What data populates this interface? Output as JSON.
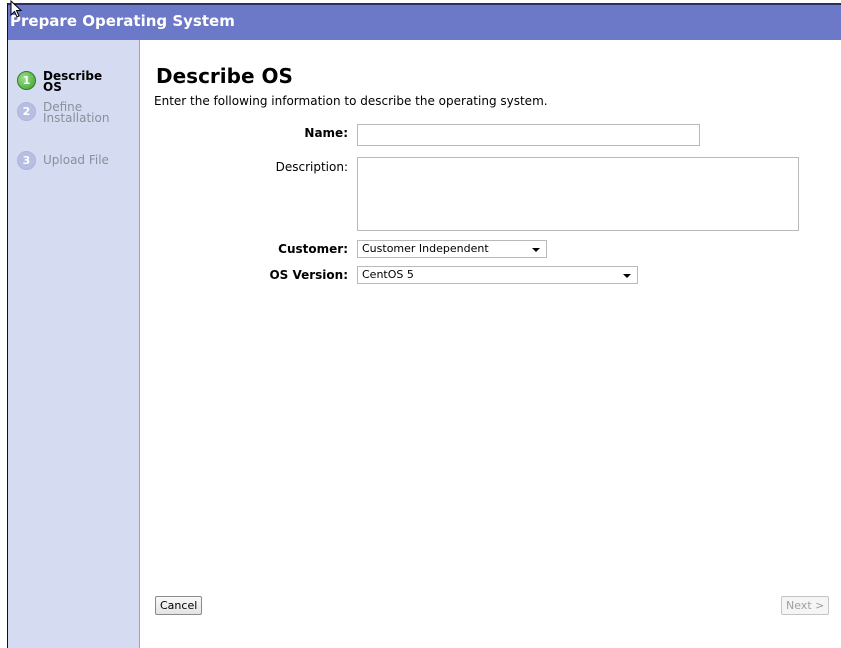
{
  "window": {
    "title": "Prepare Operating System"
  },
  "steps": [
    {
      "number": "1",
      "label_line1": "Describe",
      "label_line2": "OS",
      "state": "active"
    },
    {
      "number": "2",
      "label_line1": "Define",
      "label_line2": "Installation",
      "state": "inactive"
    },
    {
      "number": "3",
      "label_line1": "Upload File",
      "label_line2": "",
      "state": "inactive"
    }
  ],
  "main": {
    "heading": "Describe OS",
    "intro": "Enter the following information to describe the operating system."
  },
  "form": {
    "name": {
      "label": "Name:",
      "value": ""
    },
    "description": {
      "label": "Description:",
      "value": ""
    },
    "customer": {
      "label": "Customer:",
      "selected": "Customer Independent"
    },
    "os_version": {
      "label": "OS Version:",
      "selected": "CentOS 5"
    }
  },
  "buttons": {
    "cancel": "Cancel",
    "next": "Next >"
  },
  "colors": {
    "titlebar": "#6c78c8",
    "sidebar": "#d5dcf1",
    "step_active": "#3a9d2a",
    "step_inactive": "#b6bfe3"
  }
}
